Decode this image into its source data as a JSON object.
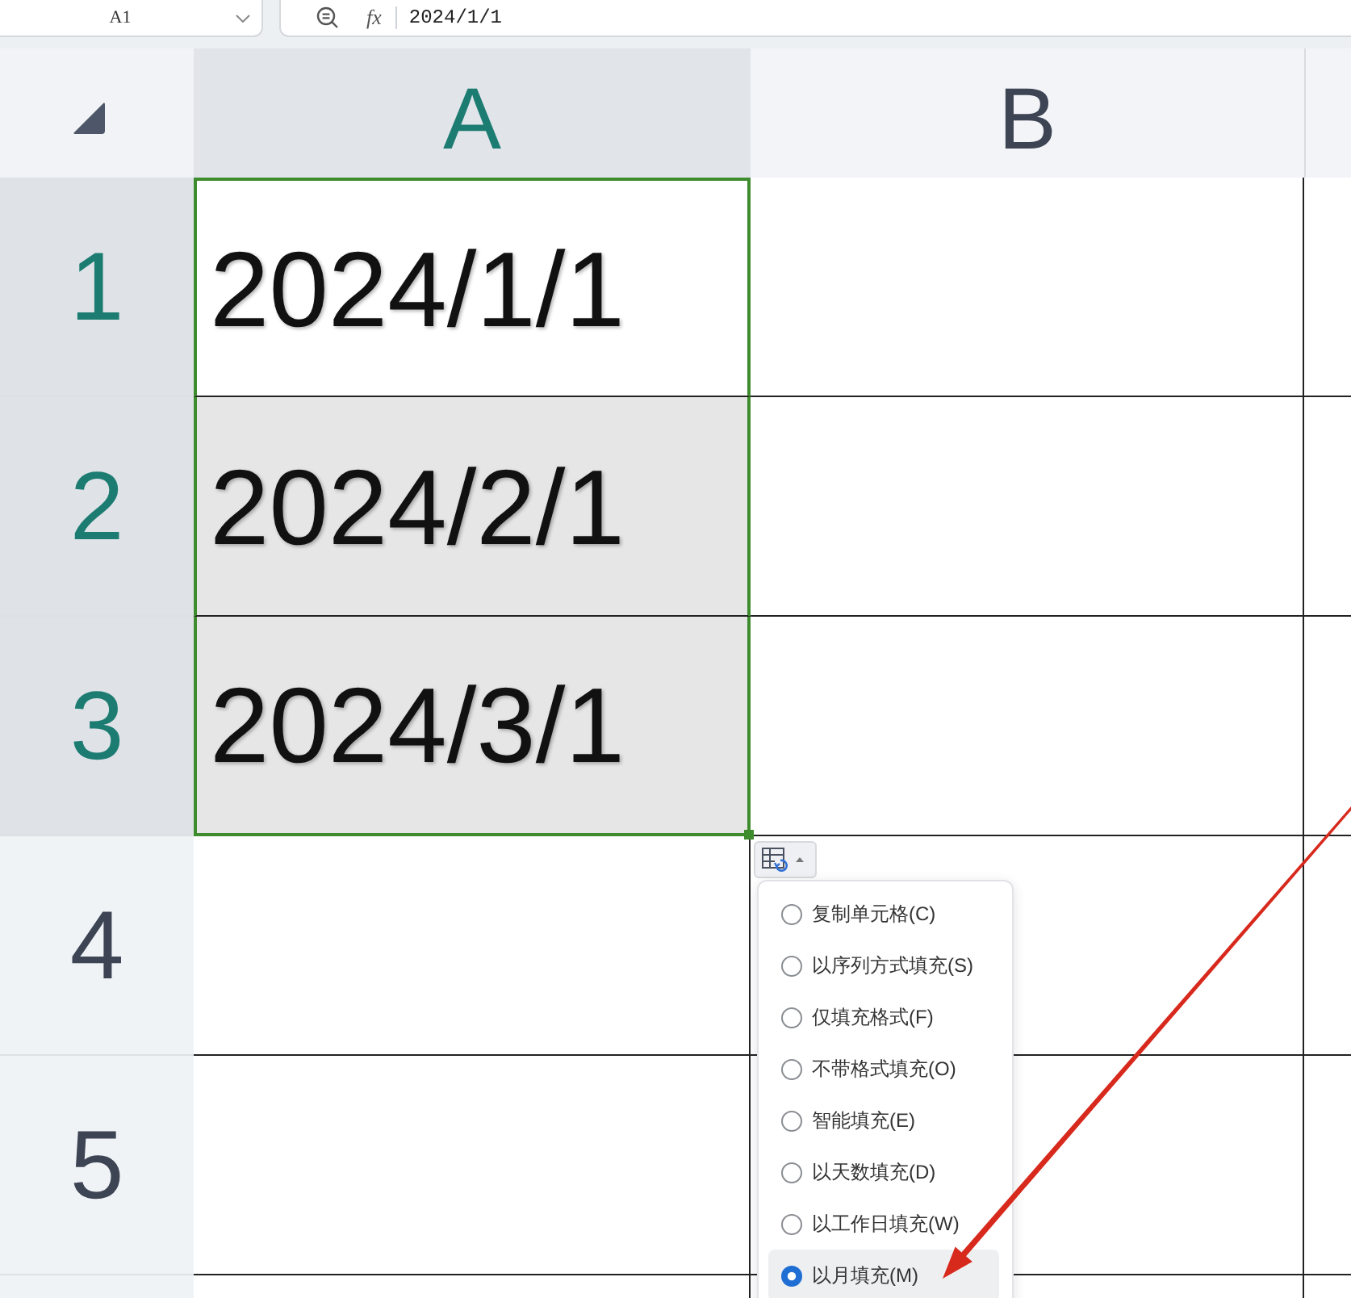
{
  "name_box": {
    "value": "A1"
  },
  "formula_bar": {
    "function_label": "fx",
    "value": "2024/1/1"
  },
  "columns": [
    {
      "label": "A",
      "selected": true
    },
    {
      "label": "B",
      "selected": false
    }
  ],
  "rows": [
    {
      "label": "1",
      "selected": true,
      "cells": [
        {
          "value": "2024/1/1",
          "selected": true,
          "active": true
        },
        {
          "selected": false,
          "active": false
        }
      ]
    },
    {
      "label": "2",
      "selected": true,
      "cells": [
        {
          "value": "2024/2/1",
          "selected": true,
          "active": false
        },
        {
          "selected": false,
          "active": false
        }
      ]
    },
    {
      "label": "3",
      "selected": true,
      "cells": [
        {
          "value": "2024/3/1",
          "selected": true,
          "active": false
        },
        {
          "selected": false,
          "active": false
        }
      ]
    },
    {
      "label": "4",
      "selected": false,
      "cells": [
        {
          "selected": false,
          "active": false
        },
        {
          "selected": false,
          "active": false
        }
      ]
    },
    {
      "label": "5",
      "selected": false,
      "cells": [
        {
          "selected": false,
          "active": false
        },
        {
          "selected": false,
          "active": false
        }
      ]
    }
  ],
  "fill_options": {
    "items": [
      {
        "label": "复制单元格(C)",
        "selected": false
      },
      {
        "label": "以序列方式填充(S)",
        "selected": false
      },
      {
        "label": "仅填充格式(F)",
        "selected": false
      },
      {
        "label": "不带格式填充(O)",
        "selected": false
      },
      {
        "label": "智能填充(E)",
        "selected": false
      },
      {
        "label": "以天数填充(D)",
        "selected": false
      },
      {
        "label": "以工作日填充(W)",
        "selected": false
      },
      {
        "label": "以月填充(M)",
        "selected": true
      }
    ]
  }
}
